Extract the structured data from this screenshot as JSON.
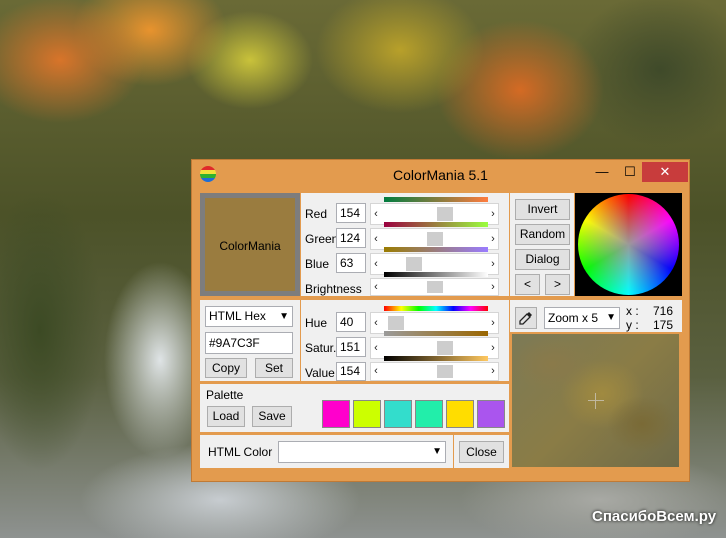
{
  "window": {
    "title": "ColorMania 5.1",
    "minimize": "—",
    "maximize": "☐",
    "close": "✕"
  },
  "preview": {
    "label": "ColorMania",
    "color": "#9A7C3F"
  },
  "rgb": {
    "red": {
      "label": "Red",
      "value": "154",
      "fraction": 0.604
    },
    "green": {
      "label": "Green",
      "value": "124",
      "fraction": 0.486
    },
    "blue": {
      "label": "Blue",
      "value": "63",
      "fraction": 0.247
    },
    "brightness": {
      "label": "Brightness",
      "fraction": 0.5
    }
  },
  "hsv": {
    "hue": {
      "label": "Hue",
      "value": "40",
      "fraction": 0.16
    },
    "saturation": {
      "label": "Satur.",
      "value": "151",
      "fraction": 0.59
    },
    "value": {
      "label": "Value",
      "value": "154",
      "fraction": 0.6
    }
  },
  "format": {
    "selected": "HTML Hex",
    "hex_value": "#9A7C3F",
    "copy_label": "Copy",
    "set_label": "Set"
  },
  "actions": {
    "invert": "Invert",
    "random": "Random",
    "dialog": "Dialog",
    "prev": "<",
    "next": ">"
  },
  "zoom": {
    "selected": "Zoom x 5",
    "x_label": "x :",
    "x_value": "716",
    "y_label": "y :",
    "y_value": "175"
  },
  "palette": {
    "title": "Palette",
    "load_label": "Load",
    "save_label": "Save",
    "colors": [
      "#FF00CC",
      "#CCFF00",
      "#33DDCC",
      "#22EEAA",
      "#FFDD00",
      "#AA55EE"
    ]
  },
  "bottom": {
    "label": "HTML Color",
    "select_value": "",
    "close_label": "Close"
  },
  "watermark": "СпасибоВсем.ру"
}
